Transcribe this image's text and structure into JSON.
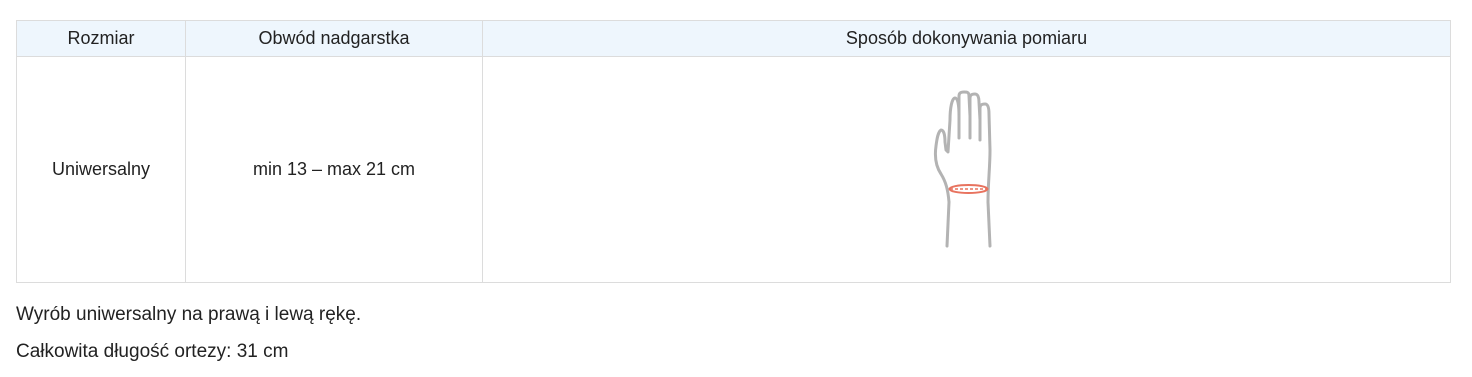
{
  "table": {
    "headers": [
      "Rozmiar",
      "Obwód nadgarstka",
      "Sposób dokonywania pomiaru"
    ],
    "rows": [
      {
        "size": "Uniwersalny",
        "circumference": "min 13 – max 21 cm"
      }
    ],
    "illustration_icon": "hand-wrist-measure-icon"
  },
  "notes": [
    "Wyrób uniwersalny na prawą i lewą rękę.",
    "Całkowita długość ortezy: 31 cm"
  ],
  "colors": {
    "header_bg": "#eef6fd",
    "border": "#dcdcdc",
    "hand_stroke": "#b3b3b3",
    "measure_line": "#e8735f"
  }
}
